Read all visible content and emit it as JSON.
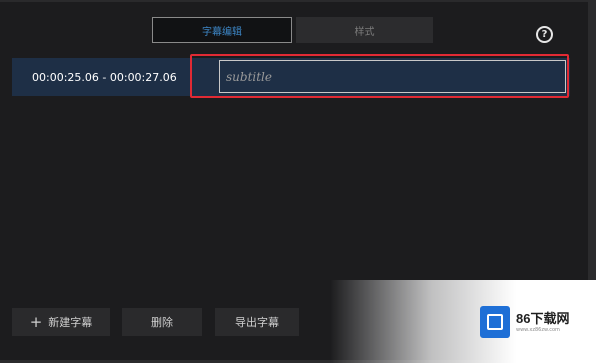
{
  "tabs": [
    {
      "label": "字幕编辑",
      "active": true
    },
    {
      "label": "样式",
      "active": false
    }
  ],
  "help": {
    "label": "?"
  },
  "subtitles": [
    {
      "time": "00:00:25.06 - 00:00:27.06",
      "text": "",
      "placeholder": "subtitle"
    }
  ],
  "buttons": {
    "new": "新建字幕",
    "delete": "删除",
    "export": "导出字幕",
    "new_icon": "+"
  },
  "watermark": {
    "name": "86下载网",
    "url": "www.xz86zw.com"
  },
  "colors": {
    "background": "#1c1c1e",
    "row_selected": "#1e2f46",
    "active_tab_text": "#3d86c6",
    "highlight_border": "#e12a34",
    "watermark_icon": "#1e6fd6"
  }
}
